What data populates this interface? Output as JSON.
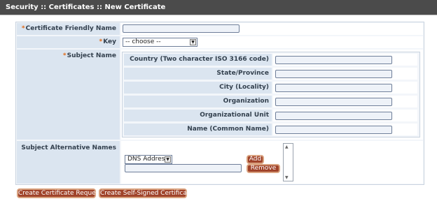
{
  "header": {
    "title": "Security :: Certificates :: New Certificate"
  },
  "form": {
    "required_marker": "*",
    "friendly_name": {
      "label": "Certificate Friendly Name",
      "value": ""
    },
    "key": {
      "label": "Key",
      "selected": "-- choose --"
    },
    "subject_name": {
      "label": "Subject Name",
      "fields": [
        {
          "label": "Country (Two character ISO 3166 code)",
          "value": ""
        },
        {
          "label": "State/Province",
          "value": ""
        },
        {
          "label": "City (Locality)",
          "value": ""
        },
        {
          "label": "Organization",
          "value": ""
        },
        {
          "label": "Organizational Unit",
          "value": ""
        },
        {
          "label": "Name (Common Name)",
          "value": ""
        }
      ]
    },
    "san": {
      "label": "Subject Alternative Names",
      "type_selected": "DNS Address",
      "value": "",
      "add_label": "Add",
      "remove_label": "Remove"
    }
  },
  "actions": {
    "create_request_label": "Create Certificate Request",
    "create_self_signed_label": "Create Self-Signed Certificate"
  },
  "colors": {
    "title_bar": "#4b4b4b",
    "label_bg": "#dbe5f0",
    "button_bg": "#a0432a",
    "required_marker": "#e06a17"
  }
}
